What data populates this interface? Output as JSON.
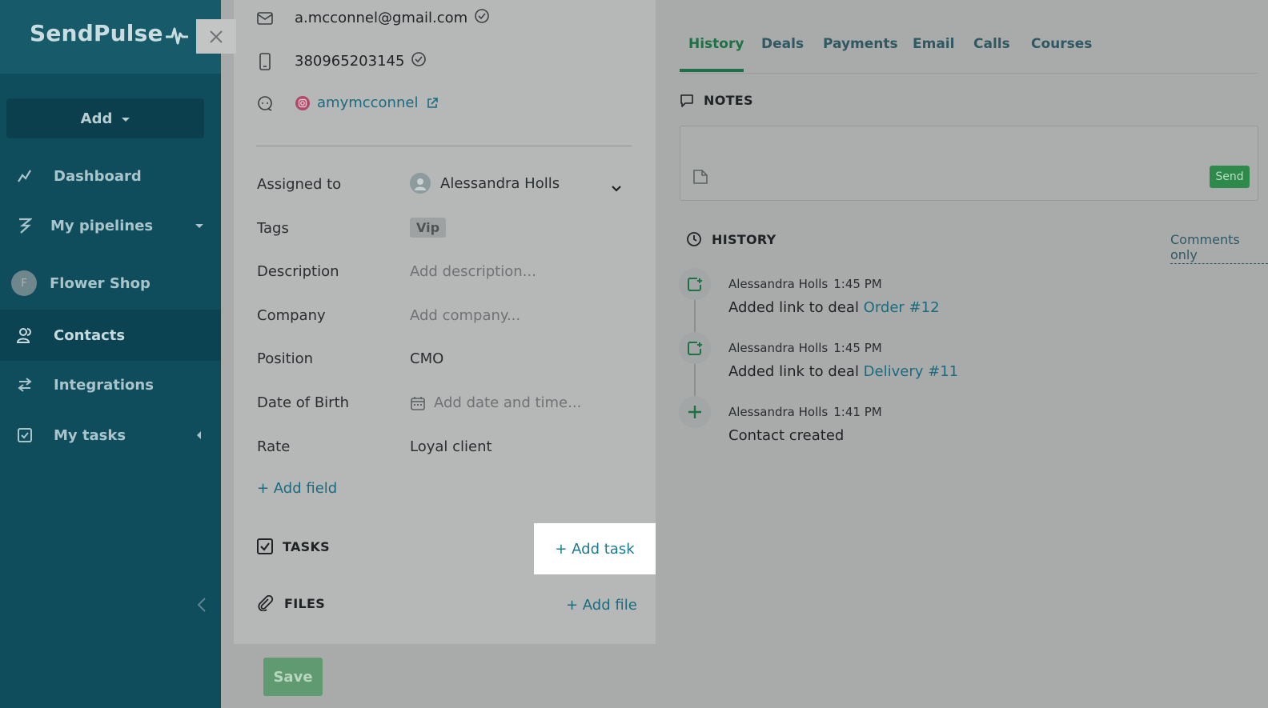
{
  "app": {
    "logo": "SendPulse"
  },
  "sidebar": {
    "add_label": "Add",
    "items": [
      {
        "label": "Dashboard",
        "icon": "chart-line-icon"
      },
      {
        "label": "My pipelines",
        "icon": "pipeline-icon"
      },
      {
        "label": "Flower Shop",
        "icon": "avatar-f",
        "avatar_letter": "F"
      },
      {
        "label": "Contacts",
        "icon": "contacts-icon"
      },
      {
        "label": "Integrations",
        "icon": "arrows-swap-icon"
      },
      {
        "label": "My tasks",
        "icon": "checkbox-icon"
      }
    ]
  },
  "contact": {
    "email": "a.mcconnel@gmail.com",
    "phone": "380965203145",
    "instagram": "amymcconnel"
  },
  "fields": {
    "assigned_label": "Assigned to",
    "assigned_value": "Alessandra Holls",
    "tags_label": "Tags",
    "tag_value": "Vip",
    "description_label": "Description",
    "description_placeholder": "Add description...",
    "company_label": "Company",
    "company_placeholder": "Add company...",
    "position_label": "Position",
    "position_value": "CMO",
    "dob_label": "Date of Birth",
    "dob_placeholder": "Add date and time...",
    "rate_label": "Rate",
    "rate_value": "Loyal client",
    "add_field": "+ Add field"
  },
  "tasks": {
    "title": "TASKS",
    "add": "+ Add task"
  },
  "files": {
    "title": "FILES",
    "add": "+ Add file"
  },
  "save_label": "Save",
  "tabs": [
    "History",
    "Deals",
    "Payments",
    "Email",
    "Calls",
    "Courses"
  ],
  "notes": {
    "title": "NOTES",
    "send_label": "Send"
  },
  "history": {
    "title": "HISTORY",
    "filter_label": "Comments only",
    "entries": [
      {
        "user": "Alessandra Holls",
        "time": "1:45 PM",
        "text": "Added link to deal ",
        "link": "Order #12"
      },
      {
        "user": "Alessandra Holls",
        "time": "1:45 PM",
        "text": "Added link to deal ",
        "link": "Delivery #11"
      },
      {
        "user": "Alessandra Holls",
        "time": "1:41 PM",
        "text": "Contact created",
        "link": ""
      }
    ]
  },
  "colors": {
    "sidebar_bg": "#0f4d5d",
    "accent_green": "#1f7045",
    "link_teal": "#1b6b80",
    "overlay_gray": "#a9abab"
  }
}
